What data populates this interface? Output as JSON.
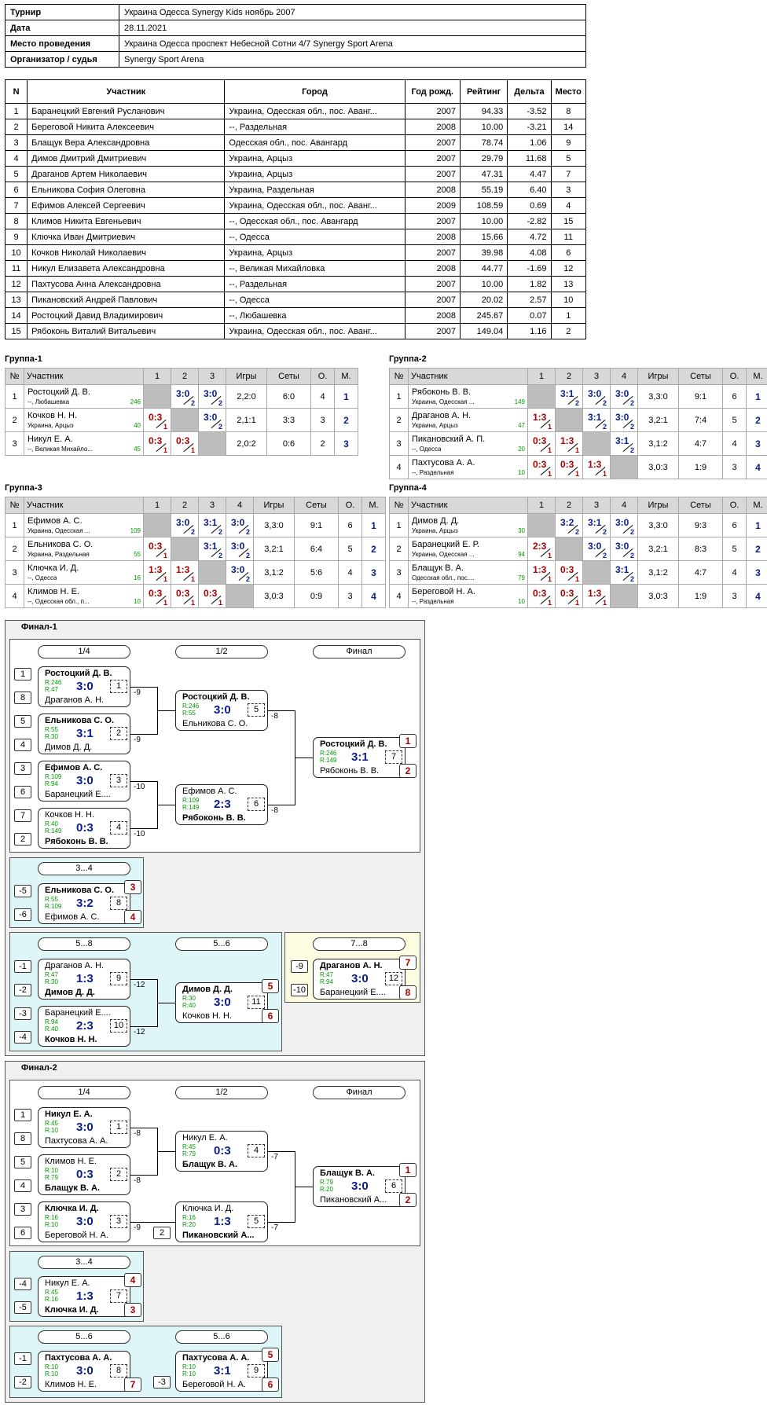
{
  "info": [
    {
      "k": "Турнир",
      "v": "Украина Одесса Synergy Kids ноябрь 2007"
    },
    {
      "k": "Дата",
      "v": "28.11.2021"
    },
    {
      "k": "Место проведения",
      "v": "Украина Одесса проспект Небесной Сотни 4/7 Synergy Sport Arena"
    },
    {
      "k": "Организатор / судья",
      "v": "Synergy Sport Arena"
    }
  ],
  "players_header": [
    "N",
    "Участник",
    "Город",
    "Год рожд.",
    "Рейтинг",
    "Дельта",
    "Место"
  ],
  "players": [
    [
      "1",
      "Баранецкий Евгений Русланович",
      "Украина, Одесская обл., пос. Аванг...",
      "2007",
      "94.33",
      "-3.52",
      "8"
    ],
    [
      "2",
      "Береговой Никита Алексеевич",
      "--, Раздельная",
      "2008",
      "10.00",
      "-3.21",
      "14"
    ],
    [
      "3",
      "Блащук Вера Александровна",
      "Одесская обл., пос. Авангард",
      "2007",
      "78.74",
      "1.06",
      "9"
    ],
    [
      "4",
      "Димов Дмитрий Дмитриевич",
      "Украина, Арцыз",
      "2007",
      "29.79",
      "11.68",
      "5"
    ],
    [
      "5",
      "Драганов Артем Николаевич",
      "Украина, Арцыз",
      "2007",
      "47.31",
      "4.47",
      "7"
    ],
    [
      "6",
      "Ельникова София Олеговна",
      "Украина, Раздельная",
      "2008",
      "55.19",
      "6.40",
      "3"
    ],
    [
      "7",
      "Ефимов Алексей Сергеевич",
      "Украина, Одесская обл., пос. Аванг...",
      "2009",
      "108.59",
      "0.69",
      "4"
    ],
    [
      "8",
      "Климов Никита Евгеньевич",
      "--, Одесская обл., пос. Авангард",
      "2007",
      "10.00",
      "-2.82",
      "15"
    ],
    [
      "9",
      "Ключка Иван Дмитриевич",
      "--, Одесса",
      "2008",
      "15.66",
      "4.72",
      "11"
    ],
    [
      "10",
      "Кочков Николай Николаевич",
      "Украина, Арцыз",
      "2007",
      "39.98",
      "4.08",
      "6"
    ],
    [
      "11",
      "Никул Елизавета Александровна",
      "--, Великая Михайловка",
      "2008",
      "44.77",
      "-1.69",
      "12"
    ],
    [
      "12",
      "Пахтусова Анна Александровна",
      "--, Раздельная",
      "2007",
      "10.00",
      "1.82",
      "13"
    ],
    [
      "13",
      "Пикановский Андрей Павлович",
      "--, Одесса",
      "2007",
      "20.02",
      "2.57",
      "10"
    ],
    [
      "14",
      "Ростоцкий Давид Владимирович",
      "--, Любашевка",
      "2008",
      "245.67",
      "0.07",
      "1"
    ],
    [
      "15",
      "Рябоконь Виталий Витальевич",
      "Украина, Одесская обл., пос. Аванг...",
      "2007",
      "149.04",
      "1.16",
      "2"
    ]
  ],
  "group_header": {
    "no": "№",
    "player": "Участник",
    "games": "Игры",
    "sets": "Сеты",
    "points": "О.",
    "place": "М."
  },
  "groups": [
    {
      "title": "Группа-1",
      "cols": [
        "1",
        "2",
        "3"
      ],
      "rows": [
        {
          "n": "1",
          "name": "Ростоцкий Д. В.",
          "city": "--, Любашевка",
          "r": "246",
          "res": [
            null,
            [
              "3:0",
              "2",
              "w"
            ],
            [
              "3:0",
              "2",
              "w"
            ]
          ],
          "games": "2,2:0",
          "sets": "6:0",
          "pts": "4",
          "pl": "1"
        },
        {
          "n": "2",
          "name": "Кочков Н. Н.",
          "city": "Украина, Арцыз",
          "r": "40",
          "res": [
            [
              "0:3",
              "1",
              "l"
            ],
            null,
            [
              "3:0",
              "2",
              "w"
            ]
          ],
          "games": "2,1:1",
          "sets": "3:3",
          "pts": "3",
          "pl": "2"
        },
        {
          "n": "3",
          "name": "Никул Е. А.",
          "city": "--, Великая Михайло...",
          "r": "45",
          "res": [
            [
              "0:3",
              "1",
              "l"
            ],
            [
              "0:3",
              "1",
              "l"
            ],
            null
          ],
          "games": "2,0:2",
          "sets": "0:6",
          "pts": "2",
          "pl": "3"
        }
      ]
    },
    {
      "title": "Группа-2",
      "cols": [
        "1",
        "2",
        "3",
        "4"
      ],
      "rows": [
        {
          "n": "1",
          "name": "Рябоконь В. В.",
          "city": "Украина, Одесская ...",
          "r": "149",
          "res": [
            null,
            [
              "3:1",
              "2",
              "w"
            ],
            [
              "3:0",
              "2",
              "w"
            ],
            [
              "3:0",
              "2",
              "w"
            ]
          ],
          "games": "3,3:0",
          "sets": "9:1",
          "pts": "6",
          "pl": "1"
        },
        {
          "n": "2",
          "name": "Драганов А. Н.",
          "city": "Украина, Арцыз",
          "r": "47",
          "res": [
            [
              "1:3",
              "1",
              "l"
            ],
            null,
            [
              "3:1",
              "2",
              "w"
            ],
            [
              "3:0",
              "2",
              "w"
            ]
          ],
          "games": "3,2:1",
          "sets": "7:4",
          "pts": "5",
          "pl": "2"
        },
        {
          "n": "3",
          "name": "Пикановский А. П.",
          "city": "--, Одесса",
          "r": "20",
          "res": [
            [
              "0:3",
              "1",
              "l"
            ],
            [
              "1:3",
              "1",
              "l"
            ],
            null,
            [
              "3:1",
              "2",
              "w"
            ]
          ],
          "games": "3,1:2",
          "sets": "4:7",
          "pts": "4",
          "pl": "3"
        },
        {
          "n": "4",
          "name": "Пахтусова А. А.",
          "city": "--, Раздельная",
          "r": "10",
          "res": [
            [
              "0:3",
              "1",
              "l"
            ],
            [
              "0:3",
              "1",
              "l"
            ],
            [
              "1:3",
              "1",
              "l"
            ],
            null
          ],
          "games": "3,0:3",
          "sets": "1:9",
          "pts": "3",
          "pl": "4"
        }
      ]
    },
    {
      "title": "Группа-3",
      "cols": [
        "1",
        "2",
        "3",
        "4"
      ],
      "rows": [
        {
          "n": "1",
          "name": "Ефимов А. С.",
          "city": "Украина, Одесская ...",
          "r": "109",
          "res": [
            null,
            [
              "3:0",
              "2",
              "w"
            ],
            [
              "3:1",
              "2",
              "w"
            ],
            [
              "3:0",
              "2",
              "w"
            ]
          ],
          "games": "3,3:0",
          "sets": "9:1",
          "pts": "6",
          "pl": "1"
        },
        {
          "n": "2",
          "name": "Ельникова С. О.",
          "city": "Украина, Раздельная",
          "r": "55",
          "res": [
            [
              "0:3",
              "1",
              "l"
            ],
            null,
            [
              "3:1",
              "2",
              "w"
            ],
            [
              "3:0",
              "2",
              "w"
            ]
          ],
          "games": "3,2:1",
          "sets": "6:4",
          "pts": "5",
          "pl": "2"
        },
        {
          "n": "3",
          "name": "Ключка И. Д.",
          "city": "--, Одесса",
          "r": "16",
          "res": [
            [
              "1:3",
              "1",
              "l"
            ],
            [
              "1:3",
              "1",
              "l"
            ],
            null,
            [
              "3:0",
              "2",
              "w"
            ]
          ],
          "games": "3,1:2",
          "sets": "5:6",
          "pts": "4",
          "pl": "3"
        },
        {
          "n": "4",
          "name": "Климов Н. Е.",
          "city": "--, Одесская обл., п...",
          "r": "10",
          "res": [
            [
              "0:3",
              "1",
              "l"
            ],
            [
              "0:3",
              "1",
              "l"
            ],
            [
              "0:3",
              "1",
              "l"
            ],
            null
          ],
          "games": "3,0:3",
          "sets": "0:9",
          "pts": "3",
          "pl": "4"
        }
      ]
    },
    {
      "title": "Группа-4",
      "cols": [
        "1",
        "2",
        "3",
        "4"
      ],
      "rows": [
        {
          "n": "1",
          "name": "Димов Д. Д.",
          "city": "Украина, Арцыз",
          "r": "30",
          "res": [
            null,
            [
              "3:2",
              "2",
              "w"
            ],
            [
              "3:1",
              "2",
              "w"
            ],
            [
              "3:0",
              "2",
              "w"
            ]
          ],
          "games": "3,3:0",
          "sets": "9:3",
          "pts": "6",
          "pl": "1"
        },
        {
          "n": "2",
          "name": "Баранецкий Е. Р.",
          "city": "Украина, Одесская ...",
          "r": "94",
          "res": [
            [
              "2:3",
              "1",
              "l"
            ],
            null,
            [
              "3:0",
              "2",
              "w"
            ],
            [
              "3:0",
              "2",
              "w"
            ]
          ],
          "games": "3,2:1",
          "sets": "8:3",
          "pts": "5",
          "pl": "2"
        },
        {
          "n": "3",
          "name": "Блащук В. А.",
          "city": "Одесская обл., пос....",
          "r": "79",
          "res": [
            [
              "1:3",
              "1",
              "l"
            ],
            [
              "0:3",
              "1",
              "l"
            ],
            null,
            [
              "3:1",
              "2",
              "w"
            ]
          ],
          "games": "3,1:2",
          "sets": "4:7",
          "pts": "4",
          "pl": "3"
        },
        {
          "n": "4",
          "name": "Береговой Н. А.",
          "city": "--, Раздельная",
          "r": "10",
          "res": [
            [
              "0:3",
              "1",
              "l"
            ],
            [
              "0:3",
              "1",
              "l"
            ],
            [
              "1:3",
              "1",
              "l"
            ],
            null
          ],
          "games": "3,0:3",
          "sets": "1:9",
          "pts": "3",
          "pl": "4"
        }
      ]
    }
  ],
  "finals": [
    {
      "title": "Финал-1",
      "rounds": [
        "1/4",
        "1/2",
        "Финал"
      ],
      "caps": [
        "3...4",
        "5...8",
        "5...6",
        "7...8"
      ],
      "seeds": [
        "1",
        "8",
        "5",
        "4",
        "3",
        "6",
        "7",
        "2",
        "-5",
        "-6",
        "-1",
        "-2",
        "-3",
        "-4",
        "-9",
        "-10"
      ],
      "matches": [
        {
          "p1": "Ростоцкий Д. В.",
          "r1": "R:246",
          "p2": "Драганов А. Н.",
          "r2": "R:47",
          "sc": "3:0",
          "no": "1",
          "lost": "-9",
          "b": 1
        },
        {
          "p1": "Ельникова С. О.",
          "r1": "R:55",
          "p2": "Димов Д. Д.",
          "r2": "R:30",
          "sc": "3:1",
          "no": "2",
          "lost": "-9",
          "b": 1
        },
        {
          "p1": "Ефимов А. С.",
          "r1": "R:109",
          "p2": "Баранецкий Е....",
          "r2": "R:94",
          "sc": "3:0",
          "no": "3",
          "lost": "-10",
          "b": 1
        },
        {
          "p1": "Кочков Н. Н.",
          "r1": "R:40",
          "p2": "Рябоконь В. В.",
          "r2": "R:149",
          "sc": "0:3",
          "no": "4",
          "lost": "-10",
          "b": 2
        },
        {
          "p1": "Ростоцкий Д. В.",
          "r1": "R:246",
          "p2": "Ельникова С. О.",
          "r2": "R:55",
          "sc": "3:0",
          "no": "5",
          "lost": "-8",
          "b": 1
        },
        {
          "p1": "Ефимов А. С.",
          "r1": "R:109",
          "p2": "Рябоконь В. В.",
          "r2": "R:149",
          "sc": "2:3",
          "no": "6",
          "lost": "-8",
          "b": 2
        },
        {
          "p1": "Ростоцкий Д. В.",
          "r1": "R:246",
          "p2": "Рябоконь В. В.",
          "r2": "R:149",
          "sc": "3:1",
          "no": "7",
          "lost": "",
          "b": 1,
          "places": [
            "1",
            "2"
          ]
        },
        {
          "p1": "Ельникова С. О.",
          "r1": "R:55",
          "p2": "Ефимов А. С.",
          "r2": "R:109",
          "sc": "3:2",
          "no": "8",
          "lost": "",
          "b": 1,
          "places": [
            "3",
            "4"
          ]
        },
        {
          "p1": "Драганов А. Н.",
          "r1": "R:47",
          "p2": "Димов Д. Д.",
          "r2": "R:30",
          "sc": "1:3",
          "no": "9",
          "lost": "-12",
          "b": 2
        },
        {
          "p1": "Баранецкий Е....",
          "r1": "R:94",
          "p2": "Кочков Н. Н.",
          "r2": "R:40",
          "sc": "2:3",
          "no": "10",
          "lost": "-12",
          "b": 2
        },
        {
          "p1": "Димов Д. Д.",
          "r1": "R:30",
          "p2": "Кочков Н. Н.",
          "r2": "R:40",
          "sc": "3:0",
          "no": "11",
          "lost": "",
          "b": 1,
          "places": [
            "5",
            "6"
          ]
        },
        {
          "p1": "Драганов А. Н.",
          "r1": "R:47",
          "p2": "Баранецкий Е....",
          "r2": "R:94",
          "sc": "3:0",
          "no": "12",
          "lost": "",
          "b": 1,
          "places": [
            "7",
            "8"
          ]
        }
      ]
    },
    {
      "title": "Финал-2",
      "rounds": [
        "1/4",
        "1/2",
        "Финал"
      ],
      "caps": [
        "3...4",
        "5...6",
        "5...6"
      ],
      "seeds": [
        "1",
        "8",
        "5",
        "4",
        "3",
        "6",
        "2",
        "-4",
        "-5",
        "-1",
        "-2",
        "-3"
      ],
      "matches": [
        {
          "p1": "Никул Е. А.",
          "r1": "R:45",
          "p2": "Пахтусова А. А.",
          "r2": "R:10",
          "sc": "3:0",
          "no": "1",
          "lost": "-8",
          "b": 1
        },
        {
          "p1": "Климов Н. Е.",
          "r1": "R:10",
          "p2": "Блащук В. А.",
          "r2": "R:79",
          "sc": "0:3",
          "no": "2",
          "lost": "-8",
          "b": 2
        },
        {
          "p1": "Ключка И. Д.",
          "r1": "R:16",
          "p2": "Береговой Н. А.",
          "r2": "R:10",
          "sc": "3:0",
          "no": "3",
          "lost": "-9",
          "b": 1
        },
        {
          "p1": "Никул Е. А.",
          "r1": "R:45",
          "p2": "Блащук В. А.",
          "r2": "R:79",
          "sc": "0:3",
          "no": "4",
          "lost": "-7",
          "b": 2
        },
        {
          "p1": "Ключка И. Д.",
          "r1": "R:16",
          "p2": "Пикановский А...",
          "r2": "R:20",
          "sc": "1:3",
          "no": "5",
          "lost": "-7",
          "b": 2
        },
        {
          "p1": "Блащук В. А.",
          "r1": "R:79",
          "p2": "Пикановский А...",
          "r2": "R:20",
          "sc": "3:0",
          "no": "6",
          "lost": "",
          "b": 1,
          "places": [
            "1",
            "2"
          ]
        },
        {
          "p1": "Никул Е. А.",
          "r1": "R:45",
          "p2": "Ключка И. Д.",
          "r2": "R:16",
          "sc": "1:3",
          "no": "7",
          "lost": "",
          "b": 2,
          "places": [
            "4",
            "3"
          ]
        },
        {
          "p1": "Пахтусова А. А.",
          "r1": "R:10",
          "p2": "Климов Н. Е.",
          "r2": "R:10",
          "sc": "3:0",
          "no": "8",
          "lost": "",
          "b": 1,
          "places": [
            "",
            "7"
          ]
        },
        {
          "p1": "Пахтусова А. А.",
          "r1": "R:10",
          "p2": "Береговой Н. А.",
          "r2": "R:10",
          "sc": "3:1",
          "no": "9",
          "lost": "",
          "b": 1,
          "places": [
            "5",
            "6"
          ]
        }
      ]
    }
  ]
}
